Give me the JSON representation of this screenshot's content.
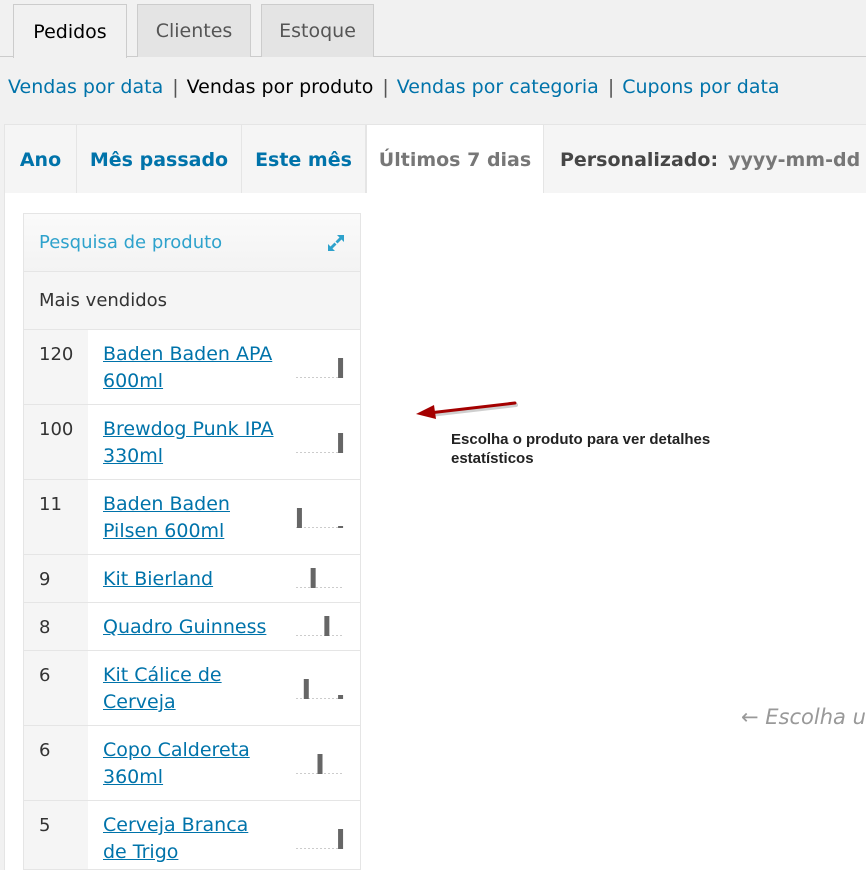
{
  "nav": {
    "tabs": [
      "Pedidos",
      "Clientes",
      "Estoque"
    ]
  },
  "subsub": {
    "links": [
      "Vendas por data",
      "Vendas por produto",
      "Vendas por categoria",
      "Cupons por data"
    ],
    "separator": "|"
  },
  "range": {
    "ano": "Ano",
    "mes_passado": "Mês passado",
    "este_mes": "Este mês",
    "ultimos": "Últimos 7 dias",
    "custom_label": "Personalizado:",
    "custom_placeholder": "yyyy-mm-dd"
  },
  "sidebar": {
    "search_title": "Pesquisa de produto",
    "top_sellers_title": "Mais vendidos",
    "products": [
      {
        "count": "120",
        "name": "Baden Baden APA 600ml",
        "spark": [
          0,
          0,
          0,
          0,
          0,
          0,
          1
        ]
      },
      {
        "count": "100",
        "name": "Brewdog Punk IPA 330ml",
        "spark": [
          0,
          0,
          0,
          0,
          0,
          0,
          1
        ]
      },
      {
        "count": "11",
        "name": "Baden Baden Pilsen 600ml",
        "spark": [
          1,
          0,
          0,
          0,
          0,
          0,
          0.1
        ]
      },
      {
        "count": "9",
        "name": "Kit Bierland",
        "spark": [
          0,
          0,
          1,
          0,
          0,
          0,
          0
        ]
      },
      {
        "count": "8",
        "name": "Quadro Guinness",
        "spark": [
          0,
          0,
          0,
          0,
          1,
          0,
          0
        ]
      },
      {
        "count": "6",
        "name": "Kit Cálice de Cerveja",
        "spark": [
          0,
          1,
          0,
          0,
          0,
          0,
          0.2
        ]
      },
      {
        "count": "6",
        "name": "Copo Caldereta 360ml",
        "spark": [
          0,
          0,
          0,
          1,
          0,
          0,
          0
        ]
      },
      {
        "count": "5",
        "name": "Cerveja Branca de Trigo",
        "spark": [
          0,
          0,
          0,
          0,
          0,
          0,
          1
        ]
      }
    ]
  },
  "annotation": {
    "text": "Escolha o produto para ver detalhes estatísticos"
  },
  "main": {
    "hint": "← Escolha u"
  }
}
